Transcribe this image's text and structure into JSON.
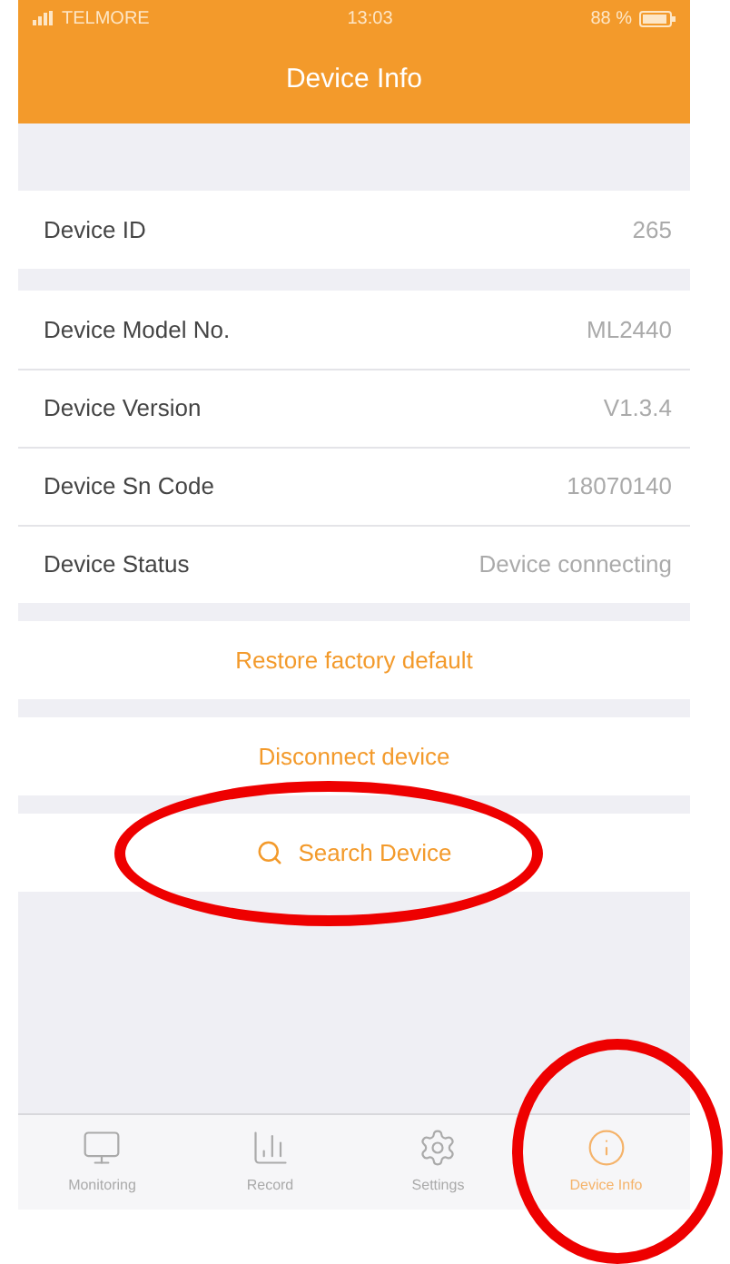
{
  "status_bar": {
    "carrier": "TELMORE",
    "time": "13:03",
    "battery": "88 %"
  },
  "nav": {
    "title": "Device Info"
  },
  "info_groups": [
    [
      {
        "label": "Device ID",
        "value": "265"
      }
    ],
    [
      {
        "label": "Device Model No.",
        "value": "ML2440"
      },
      {
        "label": "Device Version",
        "value": "V1.3.4"
      },
      {
        "label": "Device Sn Code",
        "value": "18070140"
      },
      {
        "label": "Device Status",
        "value": "Device connecting"
      }
    ]
  ],
  "actions": [
    {
      "label": "Restore factory default",
      "kind": "text",
      "highlighted": false
    },
    {
      "label": "Disconnect device",
      "kind": "text",
      "highlighted": false
    },
    {
      "label": "Search Device",
      "kind": "search",
      "highlighted": true
    }
  ],
  "tabs": [
    {
      "label": "Monitoring",
      "kind": "monitor",
      "selected": false,
      "highlighted": false
    },
    {
      "label": "Record",
      "kind": "chart",
      "selected": false,
      "highlighted": false
    },
    {
      "label": "Settings",
      "kind": "gear",
      "selected": false,
      "highlighted": false
    },
    {
      "label": "Device Info",
      "kind": "info",
      "selected": true,
      "highlighted": true
    }
  ]
}
